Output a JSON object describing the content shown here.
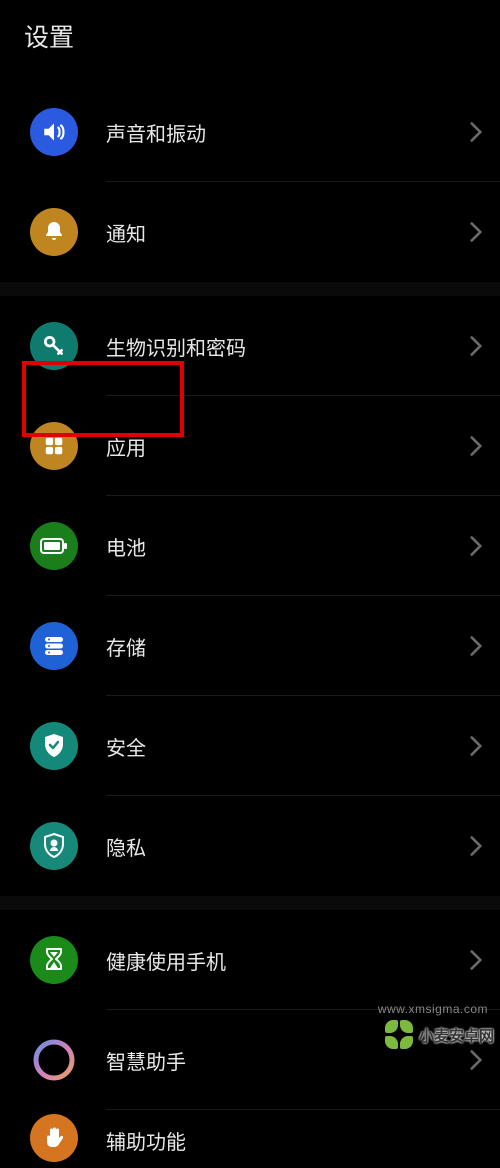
{
  "header": {
    "title": "设置"
  },
  "groups": [
    {
      "items": [
        {
          "id": "sound",
          "label": "声音和振动",
          "icon": "sound-icon",
          "color": "bg-blue"
        },
        {
          "id": "notifications",
          "label": "通知",
          "icon": "bell-icon",
          "color": "bg-gold"
        }
      ]
    },
    {
      "items": [
        {
          "id": "biometrics",
          "label": "生物识别和密码",
          "icon": "key-icon",
          "color": "bg-teal"
        },
        {
          "id": "apps",
          "label": "应用",
          "icon": "grid-icon",
          "color": "bg-gold",
          "highlighted": true
        },
        {
          "id": "battery",
          "label": "电池",
          "icon": "battery-icon",
          "color": "bg-green"
        },
        {
          "id": "storage",
          "label": "存储",
          "icon": "storage-icon",
          "color": "bg-blue2"
        },
        {
          "id": "security",
          "label": "安全",
          "icon": "shield-icon",
          "color": "bg-teal2"
        },
        {
          "id": "privacy",
          "label": "隐私",
          "icon": "privacy-icon",
          "color": "bg-teal3"
        }
      ]
    },
    {
      "items": [
        {
          "id": "digital-wellbeing",
          "label": "健康使用手机",
          "icon": "hourglass-icon",
          "color": "bg-green2"
        },
        {
          "id": "smart-assistant",
          "label": "智慧助手",
          "icon": "ring-icon",
          "color": "bg-ring"
        },
        {
          "id": "accessibility",
          "label": "辅助功能",
          "icon": "hand-icon",
          "color": "bg-orange"
        }
      ]
    }
  ],
  "watermark": {
    "brand": "小麦安卓网",
    "url": "www.xmsigma.com"
  }
}
